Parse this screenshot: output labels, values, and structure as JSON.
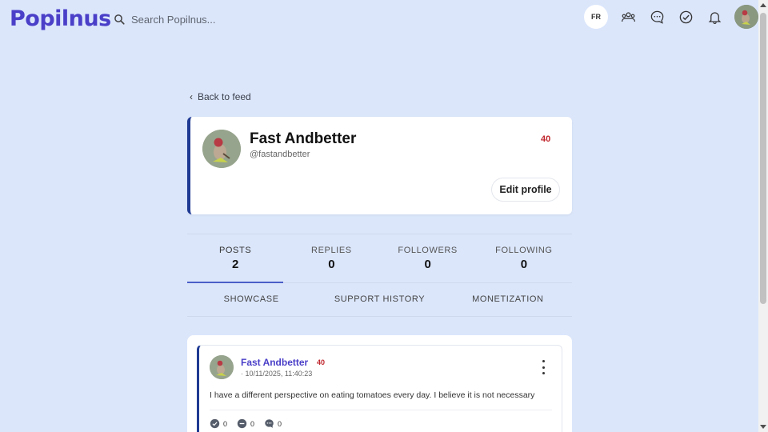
{
  "app": {
    "logo": "Popilnus"
  },
  "search": {
    "placeholder": "Search Popilnus..."
  },
  "header": {
    "lang": "FR"
  },
  "nav": {
    "back_label": "Back to feed"
  },
  "profile": {
    "name": "Fast Andbetter",
    "handle": "@fastandbetter",
    "score": "40",
    "edit_label": "Edit profile"
  },
  "stats": [
    {
      "label": "POSTS",
      "value": "2"
    },
    {
      "label": "REPLIES",
      "value": "0"
    },
    {
      "label": "FOLLOWERS",
      "value": "0"
    },
    {
      "label": "FOLLOWING",
      "value": "0"
    }
  ],
  "subtabs": [
    "SHOWCASE",
    "SUPPORT HISTORY",
    "MONETIZATION"
  ],
  "post": {
    "author": "Fast Andbetter",
    "score": "40",
    "timestamp": "· 10/11/2025, 11:40:23",
    "text": "I have a different perspective on eating tomatoes every day. I believe it is not necessary",
    "actions": [
      {
        "icon": "check-circle-icon",
        "count": "0"
      },
      {
        "icon": "minus-circle-icon",
        "count": "0"
      },
      {
        "icon": "comment-icon",
        "count": "0"
      }
    ]
  },
  "colors": {
    "brand": "#4a3fc8",
    "accent_border": "#1f3a93",
    "score": "#c0262d",
    "background": "#dbe6fb"
  }
}
